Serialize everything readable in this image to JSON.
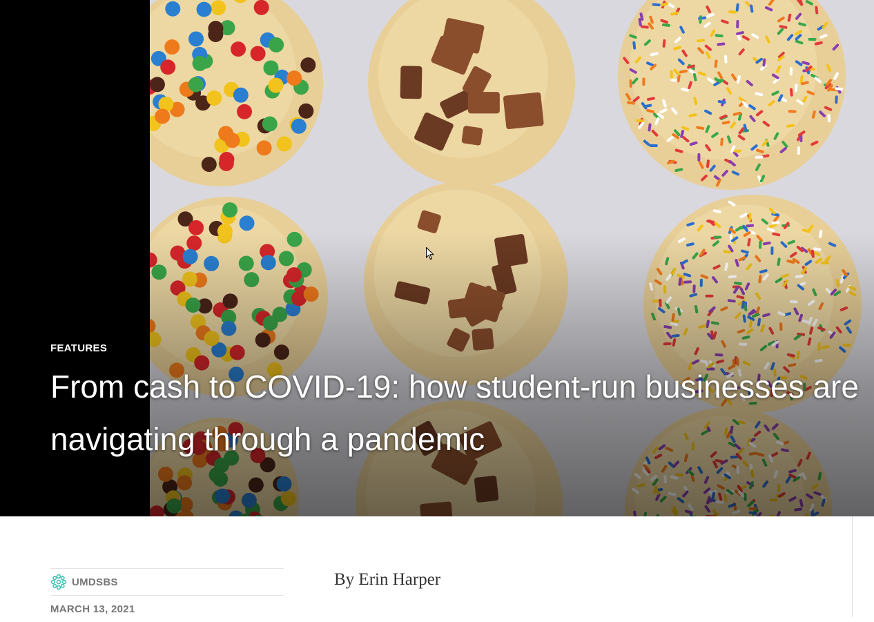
{
  "hero": {
    "image_alt": "Cookies topped with candy-coated chocolates, chocolate chunks and rainbow sprinkles",
    "category": "FEATURES",
    "headline": "From cash to COVID-19: how student-run businesses are navigating through a pandemic"
  },
  "meta": {
    "author": "UMDSBS",
    "date": "MARCH 13, 2021"
  },
  "article": {
    "byline": "By Erin Harper"
  },
  "colors": {
    "meta_text": "#767676",
    "avatar": "#3fc2b3"
  }
}
